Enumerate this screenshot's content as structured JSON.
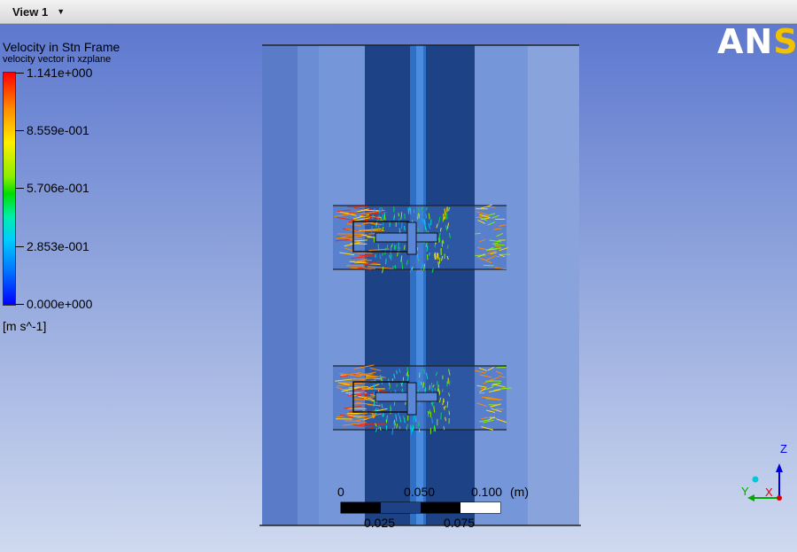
{
  "tab": {
    "label": "View 1",
    "arrow": "▼"
  },
  "legend": {
    "title": "Velocity in Stn Frame",
    "subtitle": "velocity vector in xzplane",
    "ticks": [
      "1.141e+000",
      "8.559e-001",
      "5.706e-001",
      "2.853e-001",
      "0.000e+000"
    ],
    "units": "[m s^-1]",
    "colors": [
      "#ff0000",
      "#ffee00",
      "#00dd00",
      "#00ccff",
      "#0000ff"
    ]
  },
  "logo": {
    "main": "AN",
    "highlight": "S"
  },
  "scale": {
    "top_labels": [
      "0",
      "0.050",
      "0.100",
      "(m)"
    ],
    "bottom_labels": [
      "0.025",
      "0.075"
    ]
  },
  "axes": {
    "z": "Z",
    "y": "Y",
    "x": "X"
  },
  "colors": {
    "background_top": "#5d78cf",
    "shaft": "#1d4386",
    "tank": "#6b8dd4"
  }
}
